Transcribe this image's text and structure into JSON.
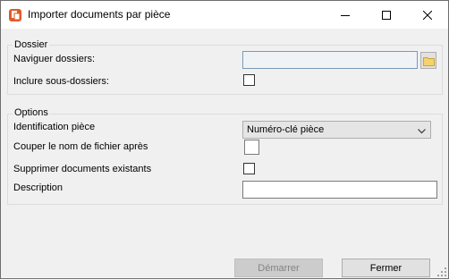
{
  "window": {
    "title": "Importer documents par pièce",
    "controls": {
      "minimize": "minimize-icon",
      "maximize": "maximize-icon",
      "close": "close-icon"
    }
  },
  "dossier_group": {
    "title": "Dossier",
    "browse_label": "Naviguer dossiers:",
    "browse_value": "",
    "include_subfolders_label": "Inclure sous-dossiers:",
    "include_subfolders_checked": false
  },
  "options_group": {
    "title": "Options",
    "identification_label": "Identification pièce",
    "identification_value": "Numéro-clé pièce",
    "cut_filename_label": "Couper le nom de fichier après",
    "cut_filename_value": "",
    "delete_existing_label": "Supprimer documents existants",
    "delete_existing_checked": false,
    "description_label": "Description",
    "description_value": ""
  },
  "footer": {
    "start_label": "Démarrer",
    "close_label": "Fermer"
  },
  "colors": {
    "app_icon": "#e0592b",
    "folder_icon": "#f5d26a",
    "disabled_text": "#838383"
  }
}
